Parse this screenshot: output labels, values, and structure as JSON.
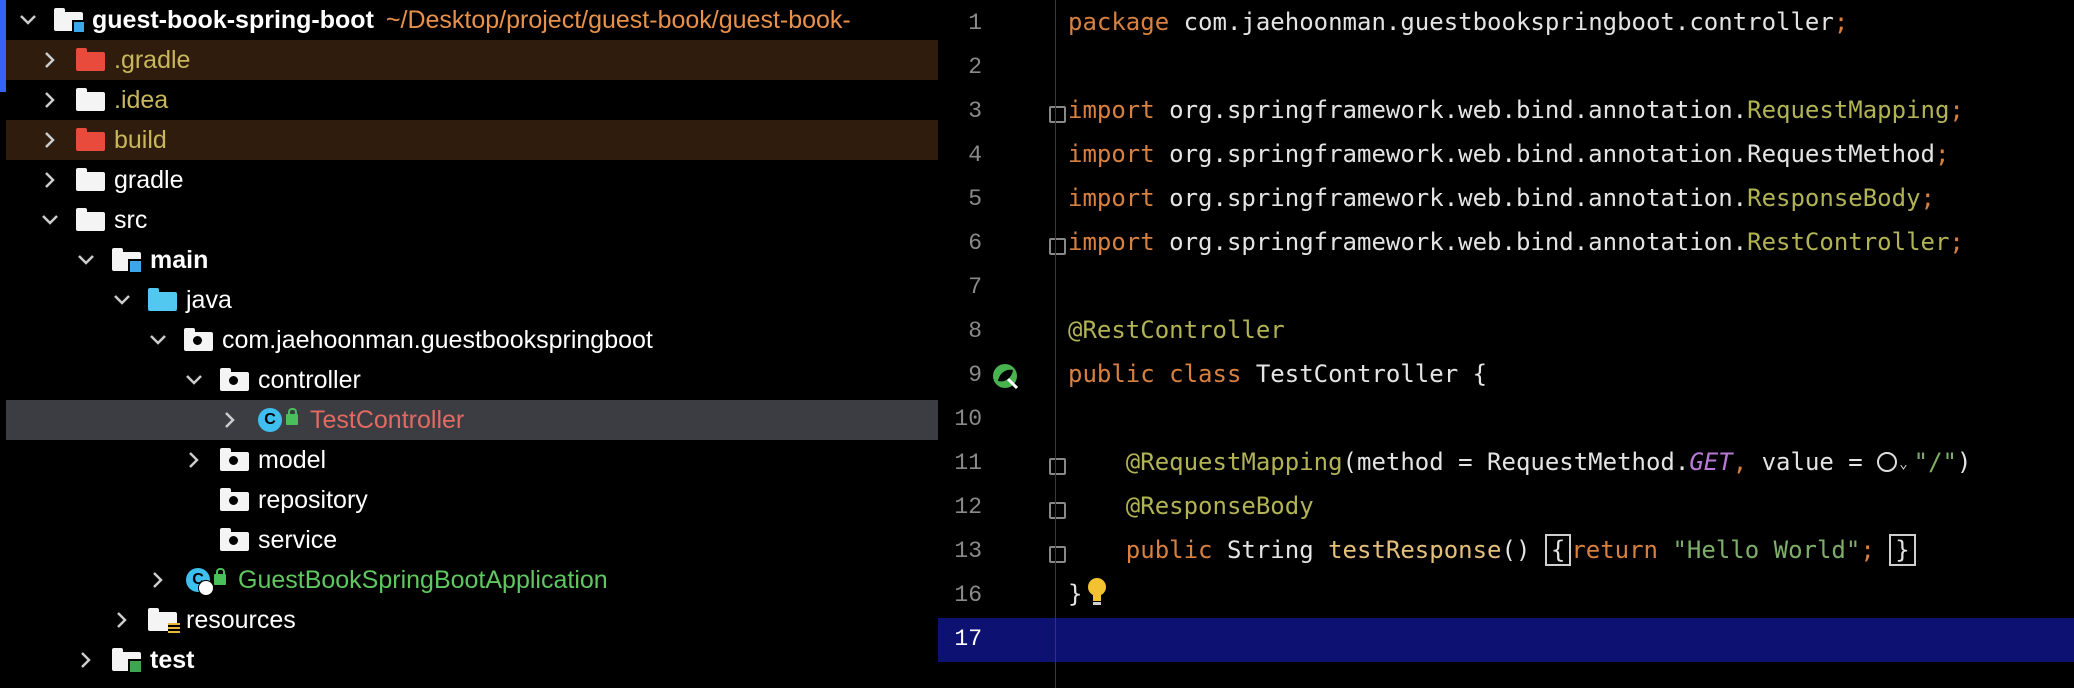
{
  "project_tree": {
    "root": {
      "label": "guest-book-spring-boot",
      "path": "~/Desktop/project/guest-book/guest-book-"
    },
    "items": [
      {
        "label": ".gradle",
        "icon": "folder-excluded-icon"
      },
      {
        "label": ".idea",
        "icon": "folder-icon"
      },
      {
        "label": "build",
        "icon": "folder-excluded-icon"
      },
      {
        "label": "gradle",
        "icon": "folder-icon"
      },
      {
        "label": "src",
        "icon": "folder-icon"
      },
      {
        "label": "main",
        "icon": "source-folder-icon"
      },
      {
        "label": "java",
        "icon": "source-root-icon"
      },
      {
        "label": "com.jaehoonman.guestbookspringboot",
        "icon": "package-icon"
      },
      {
        "label": "controller",
        "icon": "package-icon"
      },
      {
        "label": "TestController",
        "icon": "class-icon"
      },
      {
        "label": "model",
        "icon": "package-icon"
      },
      {
        "label": "repository",
        "icon": "package-icon"
      },
      {
        "label": "service",
        "icon": "package-icon"
      },
      {
        "label": "GuestBookSpringBootApplication",
        "icon": "spring-boot-class-icon"
      },
      {
        "label": "resources",
        "icon": "resources-folder-icon"
      },
      {
        "label": "test",
        "icon": "test-folder-icon"
      }
    ]
  },
  "editor": {
    "line_numbers": [
      "1",
      "2",
      "3",
      "4",
      "5",
      "6",
      "7",
      "8",
      "9",
      "10",
      "11",
      "12",
      "13",
      "16",
      "17"
    ],
    "tokens": {
      "package_kw": "package",
      "package_name": "com.jaehoonman.guestbookspringboot.controller",
      "semicolon": ";",
      "import_kw": "import",
      "pkg_prefix": "org.springframework.web.bind.annotation.",
      "RequestMapping": "RequestMapping",
      "RequestMethod": "RequestMethod",
      "ResponseBody": "ResponseBody",
      "RestController": "RestController",
      "ann_RestController": "@RestController",
      "public_kw": "public",
      "class_kw": "class",
      "class_name": "TestController",
      "open_brace": "{",
      "close_brace": "}",
      "ann_RequestMapping": "@RequestMapping",
      "mapping_args_1": "(method = RequestMethod.",
      "get_const": "GET",
      "comma": ",",
      "mapping_args_2": " value = ",
      "path_str": "\"/\"",
      "close_paren": ")",
      "ann_ResponseBody": "@ResponseBody",
      "string_type": "String",
      "method_name": "testResponse",
      "parens": "()",
      "return_kw": "return",
      "hello_str": "\"Hello World\""
    }
  },
  "colors": {
    "keyword": "#d7803f",
    "annotation": "#b2b355",
    "string": "#7fae6a",
    "current_line": "#0d1272",
    "selected_row": "#3b3d43",
    "excluded_row": "#2f1c0c"
  }
}
